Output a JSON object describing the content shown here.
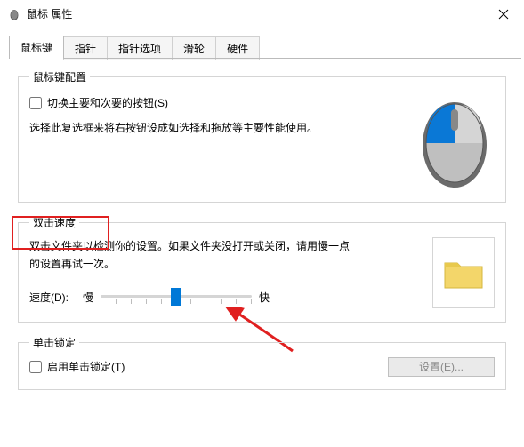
{
  "title": "鼠标 属性",
  "tabs": [
    {
      "label": "鼠标键",
      "active": true
    },
    {
      "label": "指针",
      "active": false
    },
    {
      "label": "指针选项",
      "active": false
    },
    {
      "label": "滑轮",
      "active": false
    },
    {
      "label": "硬件",
      "active": false
    }
  ],
  "button_config": {
    "legend": "鼠标键配置",
    "swap_checkbox_label": "切换主要和次要的按钮(S)",
    "swap_checked": false,
    "desc": "选择此复选框来将右按钮设成如选择和拖放等主要性能使用。"
  },
  "doubleclick": {
    "legend": "双击速度",
    "desc": "双击文件夹以检测你的设置。如果文件夹没打开或关闭，请用慢一点的设置再试一次。",
    "speed_label": "速度(D):",
    "slow": "慢",
    "fast": "快",
    "value": 5,
    "min": 0,
    "max": 10
  },
  "clicklock": {
    "legend": "单击锁定",
    "enable_label": "启用单击锁定(T)",
    "enable_checked": false,
    "settings_button": "设置(E)..."
  }
}
